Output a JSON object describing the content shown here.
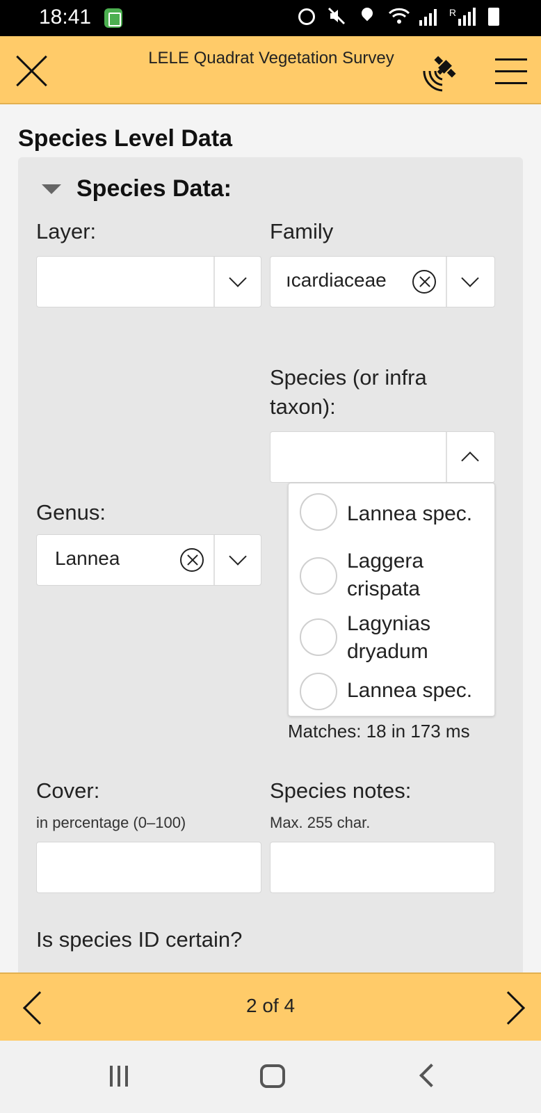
{
  "status_bar": {
    "time": "18:41",
    "signal_label": "R"
  },
  "header": {
    "title": "LELE Quadrat Vegetation Survey",
    "close_icon": "close-icon",
    "gps_icon": "satellite-icon",
    "menu_icon": "hamburger-menu-icon"
  },
  "page": {
    "title": "Species Level Data"
  },
  "group": {
    "title": "Species Data:"
  },
  "fields": {
    "layer": {
      "label": "Layer:",
      "value": ""
    },
    "family": {
      "label": "Family",
      "value": "ıcardiaceae"
    },
    "species": {
      "label": "Species (or infra taxon):",
      "value": ""
    },
    "genus": {
      "label": "Genus:",
      "value": "Lannea"
    },
    "cover": {
      "label": "Cover:",
      "hint": "in percentage (0–100)",
      "value": ""
    },
    "species_notes": {
      "label": "Species notes:",
      "hint": "Max. 255 char.",
      "value": ""
    },
    "species_id_certain": {
      "label": "Is species ID certain?"
    }
  },
  "species_dropdown": {
    "options": [
      "Lannea spec.",
      "Laggera crispata",
      "Lagynias dryadum",
      "Lannea spec."
    ],
    "matches": "Matches: 18 in 173 ms"
  },
  "footer": {
    "pager": "2 of 4"
  },
  "colors": {
    "accent": "#ffcb69",
    "panel": "#e7e7e7"
  }
}
